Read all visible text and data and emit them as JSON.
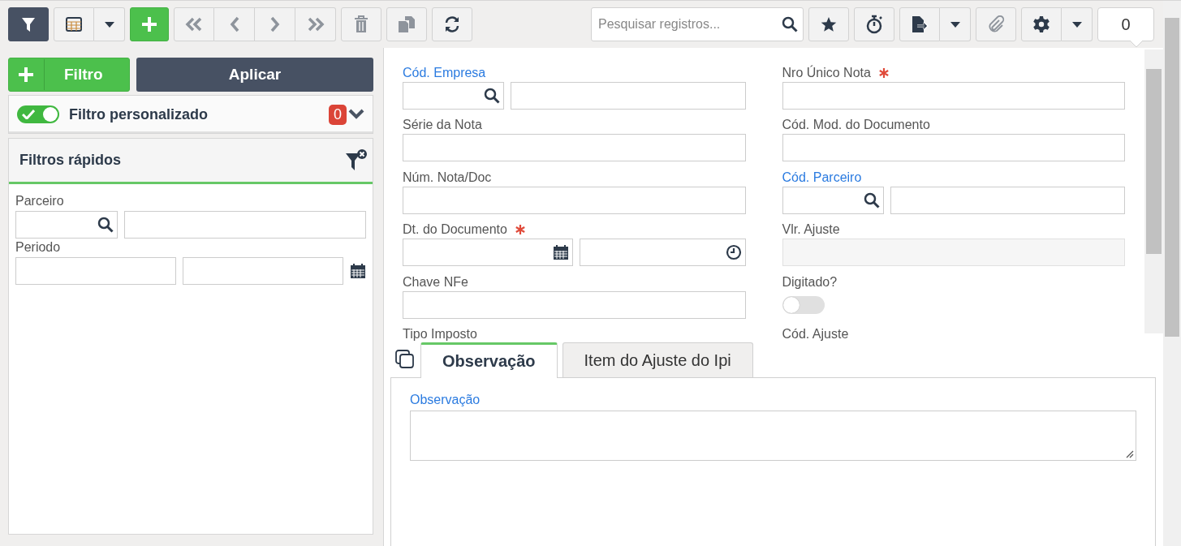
{
  "toolbar": {
    "buttons": [
      {
        "kind": "filter",
        "active": true,
        "disabled": false
      },
      {
        "kind": "grid",
        "active": false,
        "disabled": false
      },
      {
        "kind": "add",
        "active": false,
        "disabled": false
      },
      {
        "kind": "first",
        "active": false,
        "disabled": true
      },
      {
        "kind": "previous",
        "active": false,
        "disabled": true
      },
      {
        "kind": "next",
        "active": false,
        "disabled": true
      },
      {
        "kind": "last",
        "active": false,
        "disabled": true
      },
      {
        "kind": "delete",
        "active": false,
        "disabled": true
      },
      {
        "kind": "duplicate",
        "active": false,
        "disabled": true
      },
      {
        "kind": "refresh",
        "active": false,
        "disabled": false
      }
    ],
    "search": {
      "placeholder": "Pesquisar registros..."
    },
    "right_buttons": [
      {
        "kind": "star",
        "disabled": false
      },
      {
        "kind": "timer",
        "disabled": false
      },
      {
        "kind": "export",
        "disabled": false
      },
      {
        "kind": "attach",
        "disabled": true
      },
      {
        "kind": "settings",
        "disabled": false
      }
    ],
    "record_count": "0"
  },
  "filter_panel": {
    "add_button": "Filtro",
    "apply_button": "Aplicar",
    "custom_filter": {
      "label": "Filtro personalizado",
      "on": true,
      "count": "0"
    },
    "quick_filters": {
      "title": "Filtros rápidos",
      "fields": [
        {
          "label": "Parceiro",
          "kind": "lookup"
        },
        {
          "label": "Periodo",
          "kind": "daterange"
        }
      ]
    }
  },
  "form": {
    "columns": [
      [
        {
          "label": "Cód. Empresa",
          "kind": "lookup",
          "link": true,
          "required": false
        },
        {
          "label": "Série da Nota",
          "kind": "text",
          "link": false,
          "required": false
        },
        {
          "label": "Núm. Nota/Doc",
          "kind": "text",
          "link": false,
          "required": false
        },
        {
          "label": "Dt. do Documento",
          "kind": "datetime",
          "link": false,
          "required": true
        },
        {
          "label": "Chave NFe",
          "kind": "text",
          "link": false,
          "required": false
        },
        {
          "label": "Tipo Imposto",
          "link": false,
          "required": false
        }
      ],
      [
        {
          "label": "Nro Único Nota",
          "kind": "text",
          "link": false,
          "required": true
        },
        {
          "label": "Cód. Mod. do Documento",
          "kind": "text",
          "link": false,
          "required": false
        },
        {
          "label": "Cód. Parceiro",
          "kind": "lookup",
          "link": true,
          "required": false
        },
        {
          "label": "Vlr. Ajuste",
          "kind": "readonly",
          "link": false,
          "required": false
        },
        {
          "label": "Digitado?",
          "kind": "toggle",
          "on": false,
          "link": false,
          "required": false
        },
        {
          "label": "Cód. Ajuste",
          "link": false,
          "required": false
        }
      ]
    ]
  },
  "tabs": [
    {
      "label": "Observação",
      "selected": true
    },
    {
      "label": "Item do Ajuste do Ipi",
      "selected": false
    }
  ],
  "tab_panel": {
    "label": "Observação"
  }
}
